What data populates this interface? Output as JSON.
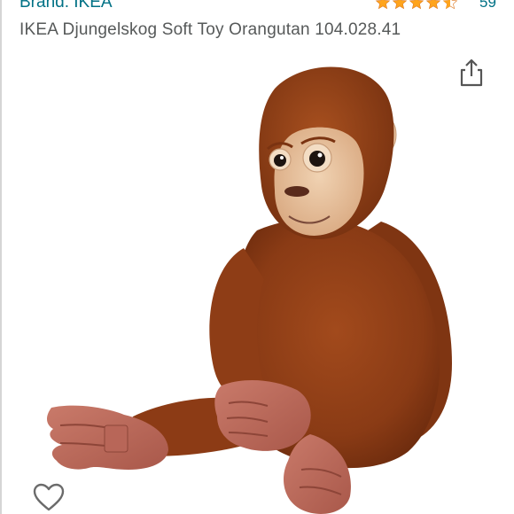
{
  "brand": {
    "label": "Brand: IKEA"
  },
  "rating": {
    "stars": 4.5,
    "count": "59",
    "star_color": "#FFA41C"
  },
  "product": {
    "title": "IKEA Djungelskog Soft Toy Orangutan 104.028.41"
  },
  "icons": {
    "share": "share-icon",
    "wishlist": "heart-outline-icon"
  },
  "colors": {
    "link": "#007185",
    "title_text": "#565959",
    "fur": "#8a3d16",
    "face": "#e8c29f"
  }
}
